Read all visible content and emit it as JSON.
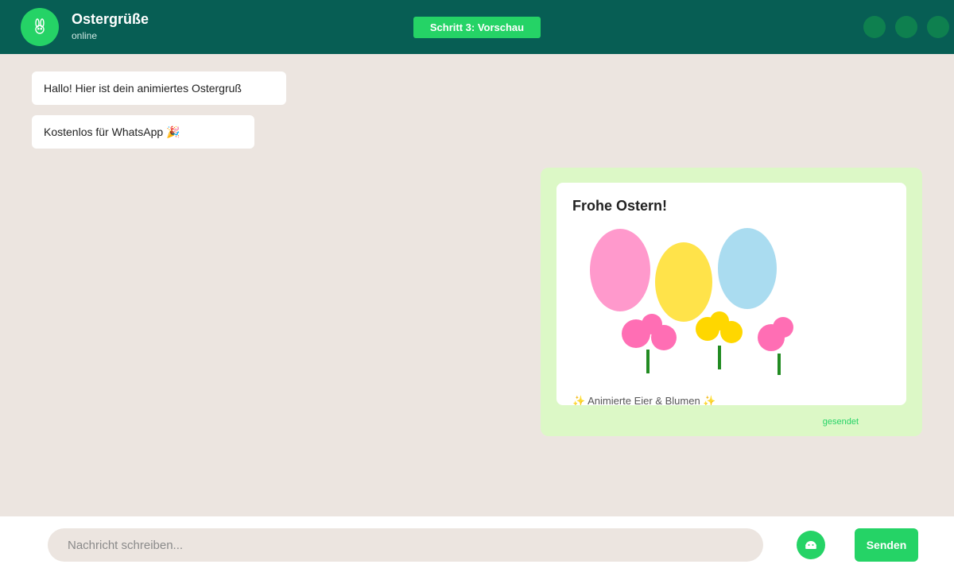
{
  "header": {
    "title": "Ostergrüße",
    "status": "online",
    "step_badge": "Schritt 3: Vorschau",
    "avatar_icon": "bunny-icon",
    "colors": {
      "bar": "#075e54",
      "accent": "#25d366"
    }
  },
  "messages": [
    {
      "direction": "in",
      "text": "Hallo! Hier ist dein animiertes Ostergruß"
    },
    {
      "direction": "in",
      "text": "Kostenlos für WhatsApp 🎉"
    }
  ],
  "preview": {
    "title": "Frohe Ostern!",
    "caption": "✨ Animierte Eier & Blumen ✨",
    "status": "gesendet",
    "eggs": [
      {
        "color": "#ff99cc"
      },
      {
        "color": "#ffe34a"
      },
      {
        "color": "#aadcf0"
      }
    ],
    "flowers": [
      {
        "color": "#ff6eb4"
      },
      {
        "color": "#ffd700"
      },
      {
        "color": "#ff6eb4"
      }
    ],
    "stem_color": "#228b22"
  },
  "composer": {
    "placeholder": "Nachricht schreiben...",
    "emoji_icon": "emoji-icon",
    "send_label": "Senden"
  }
}
